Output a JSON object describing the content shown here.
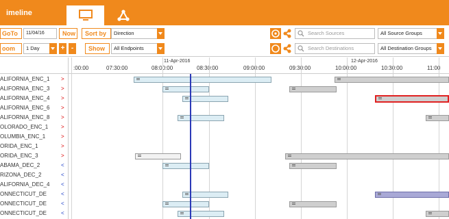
{
  "app": {
    "title": "imeline"
  },
  "tabs": [
    {
      "name": "screen-tab",
      "icon": "monitor-icon"
    },
    {
      "name": "network-tab",
      "icon": "network-icon"
    }
  ],
  "toolbar": {
    "goto_label": "GoTo",
    "goto_date": "11/04/16",
    "now_label": "Now",
    "sortby_label": "Sort by",
    "sortby_value": "Direction",
    "zoom_label": "oom",
    "zoom_value": "1 Day",
    "zoom_plus": "+",
    "zoom_minus": "-",
    "show_label": "Show",
    "show_value": "All Endpoints",
    "search_sources_placeholder": "Search Sources",
    "source_groups_value": "All Source Groups",
    "search_destinations_placeholder": "Search Destinations",
    "destination_groups_value": "All Destination Groups",
    "accent_color": "#f0891c"
  },
  "timeline": {
    "dates": [
      "11-Apr-2016",
      "12-Apr-2016"
    ],
    "times": [
      ":00:00",
      "07:30:00",
      "08:00:00",
      "08:30:00",
      "09:00:00",
      "09:30:00",
      "10:00:00",
      "10:30:00",
      "11:00"
    ],
    "rows": [
      {
        "name": "ALIFORNIA_ENC_1",
        "dir": ">",
        "kind": "out"
      },
      {
        "name": "ALIFORNIA_ENC_3",
        "dir": ">",
        "kind": "out"
      },
      {
        "name": "ALIFORNIA_ENC_4",
        "dir": ">",
        "kind": "out"
      },
      {
        "name": "ALIFORNIA_ENC_6",
        "dir": ">",
        "kind": "out"
      },
      {
        "name": "ALIFORNIA_ENC_8",
        "dir": ">",
        "kind": "out"
      },
      {
        "name": "OLORADO_ENC_1",
        "dir": ">",
        "kind": "out"
      },
      {
        "name": "OLUMBIA_ENC_1",
        "dir": ">",
        "kind": "out"
      },
      {
        "name": "ORIDA_ENC_1",
        "dir": ">",
        "kind": "out"
      },
      {
        "name": "ORIDA_ENC_3",
        "dir": ">",
        "kind": "out"
      },
      {
        "name": "ABAMA_DEC_2",
        "dir": "<",
        "kind": "in"
      },
      {
        "name": "RIZONA_DEC_2",
        "dir": "<",
        "kind": "in"
      },
      {
        "name": "ALIFORNIA_DEC_4",
        "dir": "<",
        "kind": "in"
      },
      {
        "name": "ONNECTICUT_DE",
        "dir": "<",
        "kind": "in"
      },
      {
        "name": "ONNECTICUT_DE",
        "dir": "<",
        "kind": "in"
      },
      {
        "name": "ONNECTICUT_DE",
        "dir": "<",
        "kind": "in"
      }
    ]
  }
}
